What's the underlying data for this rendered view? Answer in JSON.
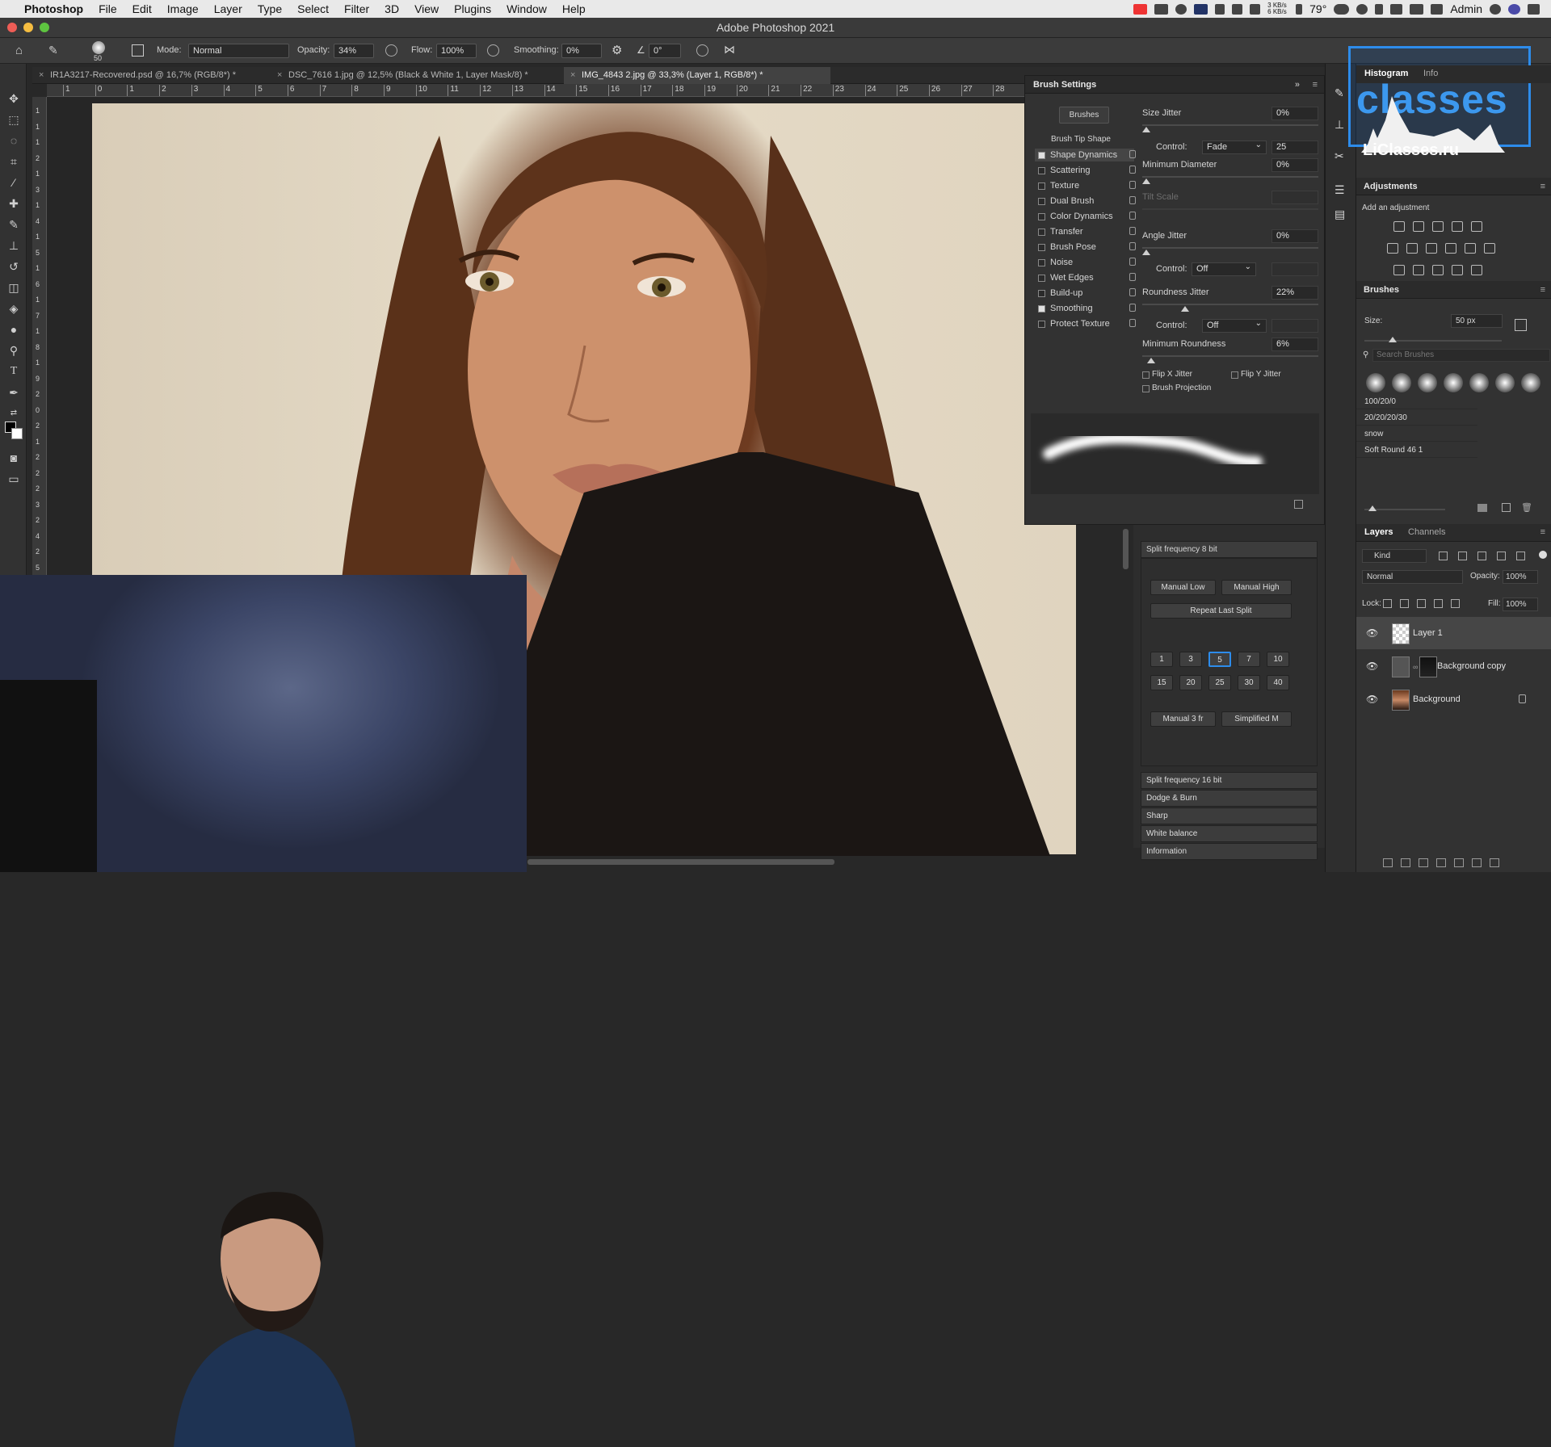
{
  "menubar": {
    "apple": "",
    "app": "Photoshop",
    "items": [
      "File",
      "Edit",
      "Image",
      "Layer",
      "Type",
      "Select",
      "Filter",
      "3D",
      "View",
      "Plugins",
      "Window",
      "Help"
    ],
    "net": "3 KB/s 6 KB/s",
    "temp": "79°",
    "user": "Admin"
  },
  "titlebar": {
    "title": "Adobe Photoshop 2021"
  },
  "options": {
    "brush_size": "50",
    "mode_label": "Mode:",
    "mode": "Normal",
    "opacity_label": "Opacity:",
    "opacity": "34%",
    "flow_label": "Flow:",
    "flow": "100%",
    "smoothing_label": "Smoothing:",
    "smoothing": "0%",
    "angle": "0°"
  },
  "tabs": [
    {
      "label": "IR1A3217-Recovered.psd @ 16,7% (RGB/8*) *"
    },
    {
      "label": "DSC_7616 1.jpg @ 12,5% (Black & White 1, Layer Mask/8) *"
    },
    {
      "label": "IMG_4843 2.jpg @ 33,3% (Layer 1, RGB/8*) *"
    }
  ],
  "ruler": {
    "h": [
      "1",
      "0",
      "1",
      "2",
      "3",
      "4",
      "5",
      "6",
      "7",
      "8",
      "9",
      "10",
      "11",
      "12",
      "13",
      "14",
      "15",
      "16",
      "17",
      "18",
      "19",
      "20",
      "21",
      "22",
      "23",
      "24",
      "25",
      "26",
      "27",
      "28",
      "29"
    ],
    "v": [
      "1",
      "1",
      "1",
      "2",
      "1",
      "3",
      "1",
      "4",
      "1",
      "5",
      "1",
      "6",
      "1",
      "7",
      "1",
      "8",
      "1",
      "9",
      "2",
      "0",
      "2",
      "1",
      "2",
      "2",
      "2",
      "3",
      "2",
      "4",
      "2",
      "5"
    ]
  },
  "brush_settings": {
    "title": "Brush Settings",
    "brushes_btn": "Brushes",
    "tip_shape": "Brush Tip Shape",
    "options": [
      {
        "label": "Shape Dynamics",
        "checked": true
      },
      {
        "label": "Scattering",
        "checked": false
      },
      {
        "label": "Texture",
        "checked": false
      },
      {
        "label": "Dual Brush",
        "checked": false
      },
      {
        "label": "Color Dynamics",
        "checked": false
      },
      {
        "label": "Transfer",
        "checked": false
      },
      {
        "label": "Brush Pose",
        "checked": false
      },
      {
        "label": "Noise",
        "checked": false
      },
      {
        "label": "Wet Edges",
        "checked": false
      },
      {
        "label": "Build-up",
        "checked": false
      },
      {
        "label": "Smoothing",
        "checked": true
      },
      {
        "label": "Protect Texture",
        "checked": false
      }
    ],
    "size_jitter": {
      "label": "Size Jitter",
      "value": "0%"
    },
    "control1": {
      "label": "Control:",
      "value": "Fade",
      "num": "25"
    },
    "min_diameter": {
      "label": "Minimum Diameter",
      "value": "0%"
    },
    "tilt_scale": {
      "label": "Tilt Scale"
    },
    "angle_jitter": {
      "label": "Angle Jitter",
      "value": "0%"
    },
    "control2": {
      "label": "Control:",
      "value": "Off"
    },
    "roundness_jitter": {
      "label": "Roundness Jitter",
      "value": "22%"
    },
    "control3": {
      "label": "Control:",
      "value": "Off"
    },
    "min_roundness": {
      "label": "Minimum Roundness",
      "value": "6%"
    },
    "flip_x": "Flip X Jitter",
    "flip_y": "Flip Y Jitter",
    "projection": "Brush Projection"
  },
  "actions": {
    "header": "Split frequency 8 bit",
    "buttons": [
      "Manual Low",
      "Manual High"
    ],
    "repeat": "Repeat Last Split",
    "radius1": [
      "1",
      "3",
      "5",
      "7",
      "10"
    ],
    "radius2": [
      "15",
      "20",
      "25",
      "30",
      "40"
    ],
    "buttons2": [
      "Manual 3 fr",
      "Simplified M"
    ],
    "groups": [
      "Split frequency 16 bit",
      "Dodge & Burn",
      "Sharp",
      "White balance",
      "Information"
    ]
  },
  "right": {
    "hist_tab": "Histogram",
    "info_tab": "Info",
    "watermark": "classes",
    "watermark2": "LiClasses.ru",
    "adj_title": "Adjustments",
    "adj_sub": "Add an adjustment",
    "brushes_title": "Brushes",
    "size_label": "Size:",
    "size": "50 px",
    "search": "Search Brushes",
    "presets": [
      "100/20/0",
      "20/20/20/30",
      "snow",
      "Soft Round 46 1"
    ],
    "layers_tab": "Layers",
    "channels_tab": "Channels",
    "kind": "Kind",
    "blend": "Normal",
    "opacity_label": "Opacity:",
    "opacity": "100%",
    "lock_label": "Lock:",
    "fill_label": "Fill:",
    "fill": "100%",
    "layers": [
      "Layer 1",
      "Background copy",
      "Background"
    ]
  },
  "colors": {
    "accent": "#2d8ceb",
    "panel": "#323232",
    "canvas": "#262626"
  }
}
